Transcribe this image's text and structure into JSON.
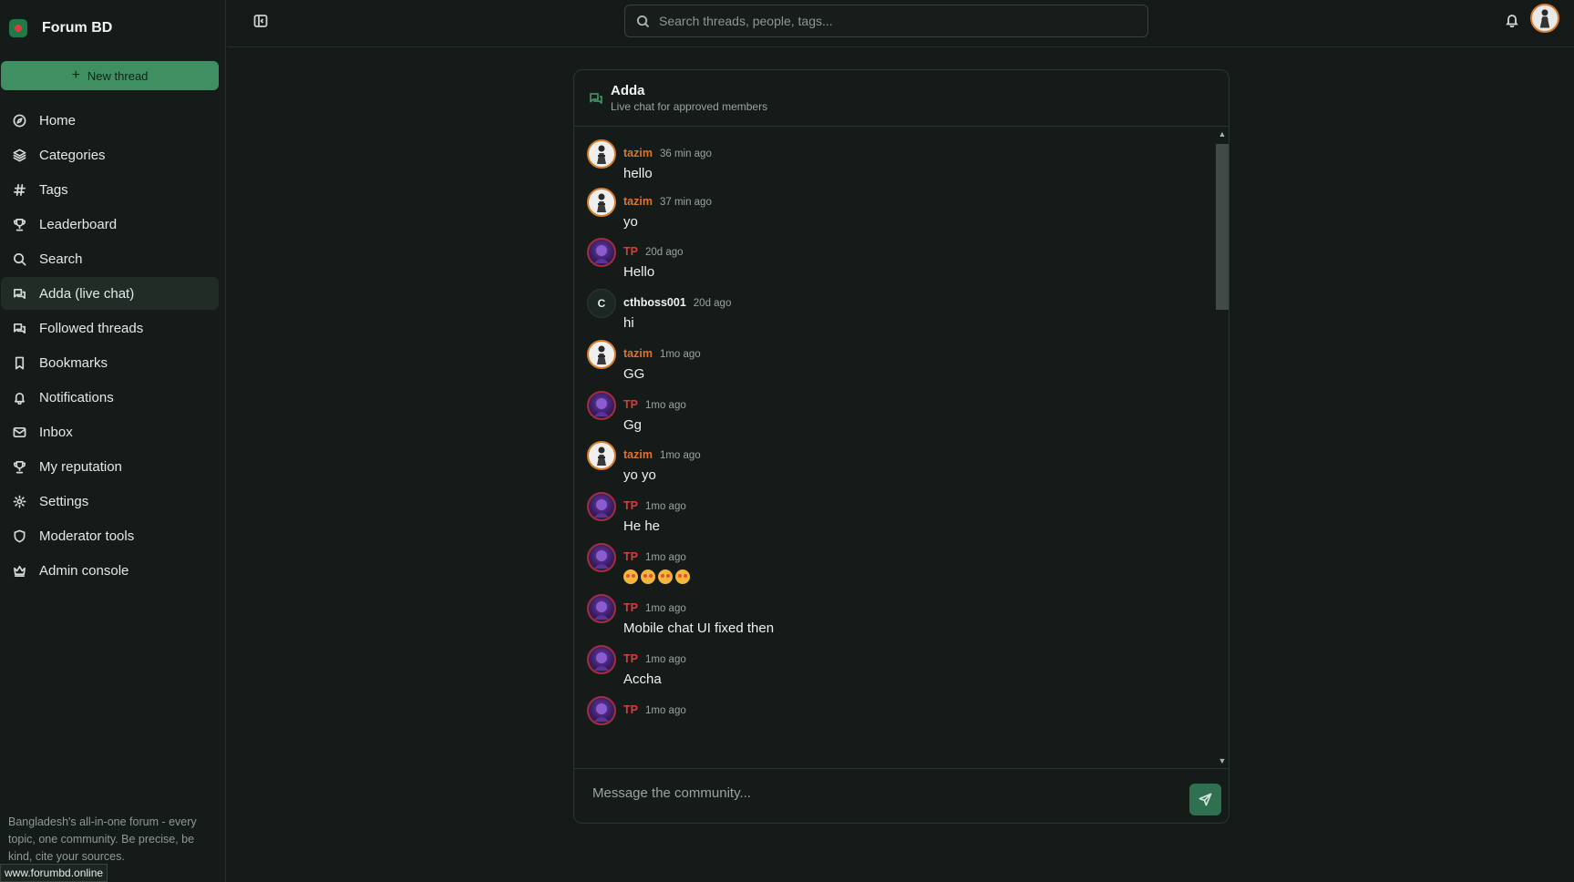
{
  "brand": {
    "name": "Forum BD"
  },
  "sidebar": {
    "new_thread_label": "New thread",
    "items": [
      {
        "label": "Home",
        "icon": "compass-icon",
        "active": false
      },
      {
        "label": "Categories",
        "icon": "layers-icon",
        "active": false
      },
      {
        "label": "Tags",
        "icon": "hash-icon",
        "active": false
      },
      {
        "label": "Leaderboard",
        "icon": "trophy-icon",
        "active": false
      },
      {
        "label": "Search",
        "icon": "search-icon",
        "active": false
      },
      {
        "label": "Adda (live chat)",
        "icon": "chat-icon",
        "active": true
      },
      {
        "label": "Followed threads",
        "icon": "chat-icon",
        "active": false
      },
      {
        "label": "Bookmarks",
        "icon": "bookmark-icon",
        "active": false
      },
      {
        "label": "Notifications",
        "icon": "bell-icon",
        "active": false
      },
      {
        "label": "Inbox",
        "icon": "mail-icon",
        "active": false
      },
      {
        "label": "My reputation",
        "icon": "trophy-icon",
        "active": false
      },
      {
        "label": "Settings",
        "icon": "gear-icon",
        "active": false
      },
      {
        "label": "Moderator tools",
        "icon": "shield-icon",
        "active": false
      },
      {
        "label": "Admin console",
        "icon": "crown-icon",
        "active": false
      }
    ],
    "footer_lines": [
      "Bangladesh's all-in-one forum - every",
      "topic, one community. Be precise, be",
      "kind, cite your sources."
    ]
  },
  "status_url": "www.forumbd.online",
  "search": {
    "placeholder": "Search threads, people, tags..."
  },
  "chat": {
    "title": "Adda",
    "subtitle": "Live chat for approved members",
    "composer_placeholder": "Message the community...",
    "messages": [
      {
        "author": "tazim",
        "time": "36 min ago",
        "text": "hello",
        "avatar": "tazim"
      },
      {
        "author": "tazim",
        "time": "37 min ago",
        "text": "yo",
        "avatar": "tazim"
      },
      {
        "author": "TP",
        "time": "20d ago",
        "text": "Hello",
        "avatar": "tp"
      },
      {
        "author": "cthboss001",
        "time": "20d ago",
        "text": "hi",
        "avatar": "letter",
        "initial": "C"
      },
      {
        "author": "tazim",
        "time": "1mo ago",
        "text": "GG",
        "avatar": "tazim"
      },
      {
        "author": "TP",
        "time": "1mo ago",
        "text": "Gg",
        "avatar": "tp"
      },
      {
        "author": "tazim",
        "time": "1mo ago",
        "text": "yo yo",
        "avatar": "tazim"
      },
      {
        "author": "TP",
        "time": "1mo ago",
        "text": "He he",
        "avatar": "tp"
      },
      {
        "author": "TP",
        "time": "1mo ago",
        "text": "🤩🤩🤩🤩",
        "avatar": "tp",
        "emoji": true
      },
      {
        "author": "TP",
        "time": "1mo ago",
        "text": "Mobile chat UI fixed then",
        "avatar": "tp"
      },
      {
        "author": "TP",
        "time": "1mo ago",
        "text": "Accha",
        "avatar": "tp"
      },
      {
        "author": "TP",
        "time": "1mo ago",
        "text": "",
        "avatar": "tp"
      }
    ]
  },
  "colors": {
    "accent": "#3f8f62",
    "tazim_name": "#e0732a",
    "tp_name": "#d63c3c",
    "background": "#131a17"
  }
}
